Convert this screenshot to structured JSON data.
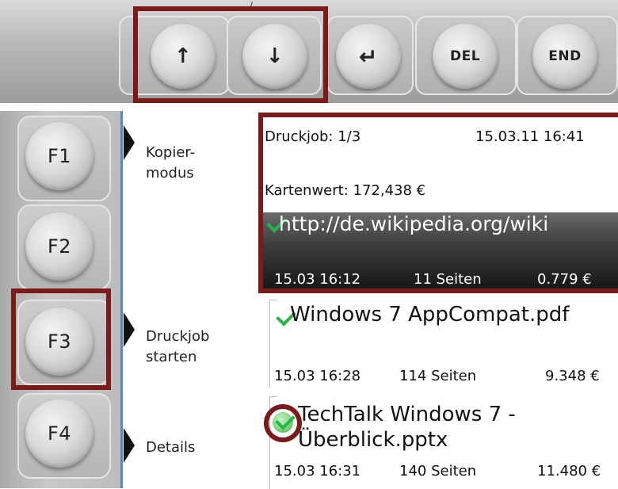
{
  "keypad": {
    "top_caption": "… /",
    "keys": [
      {
        "label": "↑",
        "name": "up-arrow-key"
      },
      {
        "label": "↓",
        "name": "down-arrow-key"
      },
      {
        "label": "↵",
        "name": "enter-key"
      },
      {
        "label": "DEL",
        "name": "del-key"
      },
      {
        "label": "END",
        "name": "end-key"
      }
    ],
    "function_keys": [
      "F1",
      "F2",
      "F3",
      "F4"
    ]
  },
  "softkeys": {
    "f1_label": "Kopier-\nmodus",
    "f3_label": "Druckjob\nstarten",
    "f4_label": "Details"
  },
  "status": {
    "job_counter": "Druckjob: 1/3",
    "datetime": "15.03.11 16:41",
    "card_value": "Kartenwert: 172,438 €"
  },
  "jobs": [
    {
      "name": "http://de.wikipedia.org/wiki",
      "date": "15.03 16:12",
      "pages": "11 Seiten",
      "price": "0.779 €",
      "selected": true
    },
    {
      "name": "Windows 7 AppCompat.pdf",
      "date": "15.03 16:28",
      "pages": "114 Seiten",
      "price": "9.348 €",
      "selected": false
    },
    {
      "name_line1": "TechTalk Windows 7 -",
      "name_line2": "Überblick.pptx",
      "date": "15.03 16:31",
      "pages": "140 Seiten",
      "price": "11.480 €",
      "selected": false
    }
  ],
  "colors": {
    "highlight": "#7b1a1a",
    "check": "#27b44a",
    "divider": "#5b86c8"
  }
}
